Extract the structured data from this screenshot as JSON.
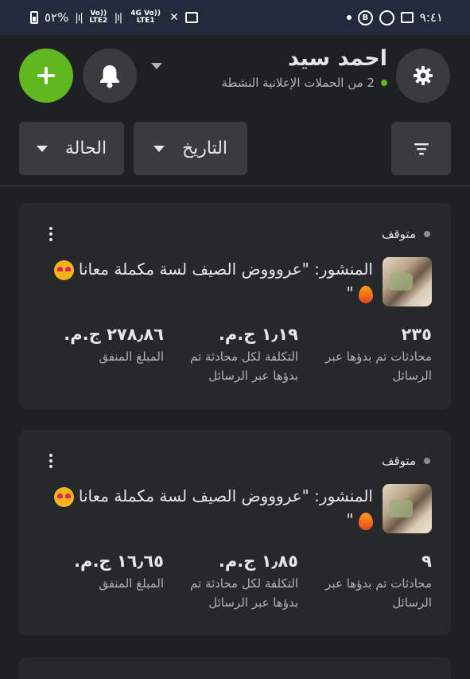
{
  "status_bar": {
    "battery": "٥٢%",
    "network_1": "Vo)) LTE2",
    "network_2": "4G Vo)) LTE1",
    "time": "٩:٤١"
  },
  "profile": {
    "name": "احمد سيد",
    "active_campaigns": "2 من الحملات الإعلانية النشطة"
  },
  "filters": {
    "status_label": "الحالة",
    "date_label": "التاريخ"
  },
  "colors": {
    "accent_green": "#5fb81e",
    "background": "#1f2023",
    "card": "#27282b",
    "button": "#3a3b3f"
  },
  "icons": {
    "settings": "gear-icon",
    "notifications": "bell-icon",
    "add": "plus-icon",
    "filter": "filter-icon"
  },
  "campaigns": [
    {
      "status": "متوقف",
      "title": "المنشور: \"عروووض الصيف لسة مكملة معانا",
      "title_end": "\"",
      "conversations_value": "٢٣٥",
      "conversations_label": "محادثات تم بدؤها عبر الرسائل",
      "cost_value": "١٫١٩ ج.م.",
      "cost_label": "التكلفة لكل محادثة تم بدؤها عبر الرسائل",
      "spent_value": "٢٧٨٫٨٦ ج.م.",
      "spent_label": "المبلغ المنفق"
    },
    {
      "status": "متوقف",
      "title": "المنشور: \"عروووض الصيف لسة مكملة معانا",
      "title_end": "\"",
      "conversations_value": "٩",
      "conversations_label": "محادثات تم بدؤها عبر الرسائل",
      "cost_value": "١٫٨٥ ج.م.",
      "cost_label": "التكلفة لكل محادثة تم بدؤها عبر الرسائل",
      "spent_value": "١٦٫٦٥ ج.م.",
      "spent_label": "المبلغ المنفق"
    }
  ]
}
